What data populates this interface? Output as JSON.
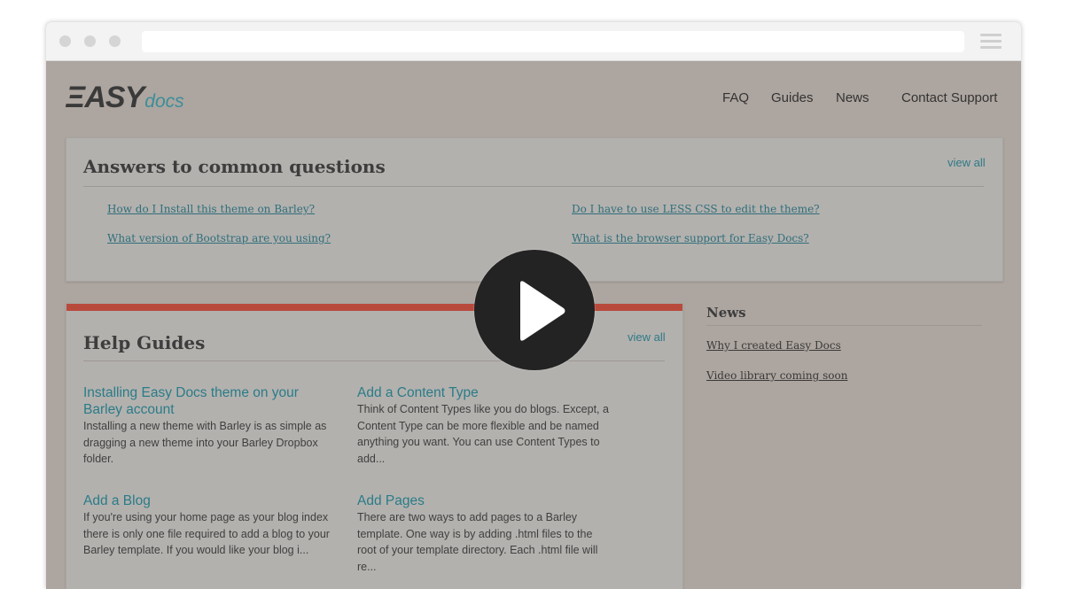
{
  "header": {
    "logo_main": "ΞASY",
    "logo_sub": "docs",
    "nav": [
      "FAQ",
      "Guides",
      "News",
      "Contact Support"
    ]
  },
  "faq": {
    "title": "Answers to common questions",
    "view_all": "view all",
    "questions": [
      "How do I Install this theme on Barley?",
      "Do I have to use LESS CSS to edit the theme?",
      "What version of Bootstrap are you using?",
      "What is the browser support for Easy Docs?"
    ]
  },
  "guides": {
    "title": "Help Guides",
    "view_all": "view all",
    "items": [
      {
        "title": "Installing Easy Docs theme on your Barley account",
        "text": "Installing a new theme with Barley is as simple as dragging a new theme into your Barley Dropbox folder."
      },
      {
        "title": "Add a Content Type",
        "text": "Think of Content Types like you do blogs. Except, a Content Type can be more flexible and be named anything you want. You can use Content Types to add..."
      },
      {
        "title": "Add a Blog",
        "text": "If you're using your home page as your blog index there is only one file required to add a blog to your Barley template. If you would like your blog i..."
      },
      {
        "title": "Add Pages",
        "text": "There are two ways to add pages to a Barley template. One way is by adding .html files to the root of your template directory. Each .html file will re..."
      }
    ]
  },
  "news": {
    "title": "News",
    "items": [
      "Why I created Easy Docs",
      "Video library coming soon"
    ]
  },
  "icons": {
    "play": "play-icon",
    "menu": "hamburger-menu-icon"
  },
  "colors": {
    "accent": "#2f7a86",
    "overlay_bg": "#ada59f",
    "guides_bar": "#b84a3c"
  }
}
